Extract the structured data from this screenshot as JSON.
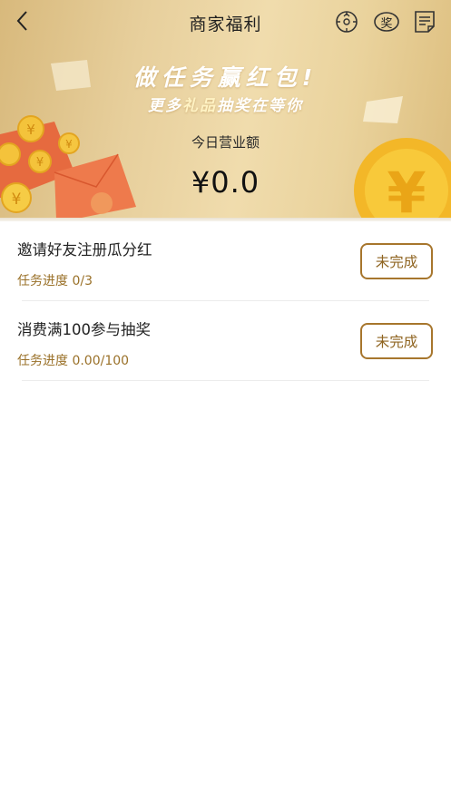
{
  "header": {
    "title": "商家福利"
  },
  "banner": {
    "slogan_line1": "做任务赢红包!",
    "slogan_line2_a": "更多",
    "slogan_line2_highlight": "礼品",
    "slogan_line2_b": "抽奖在等你",
    "revenue_label": "今日营业额",
    "revenue_value": "¥0.0",
    "coin_symbol": "¥",
    "award_icon_char": "奖"
  },
  "tasks": [
    {
      "title": "邀请好友注册瓜分红",
      "progress": "任务进度 0/3",
      "status": "未完成"
    },
    {
      "title": "消费满100参与抽奖",
      "progress": "任务进度 0.00/100",
      "status": "未完成"
    }
  ],
  "colors": {
    "accent": "#a7762d",
    "progress_text": "#9a7129",
    "banner_gold": "#e7cf9c"
  },
  "icons": [
    "back-arrow-icon",
    "lucky-wheel-icon",
    "award-icon",
    "notes-icon"
  ]
}
